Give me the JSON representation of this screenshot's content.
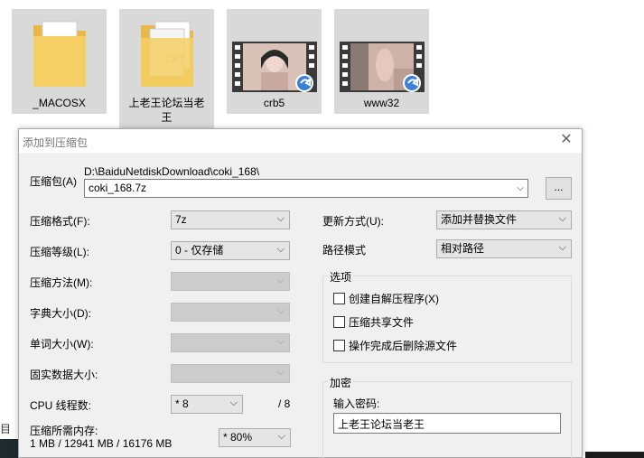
{
  "explorer": {
    "files": [
      {
        "name": "_MACOSX",
        "type": "folder"
      },
      {
        "name_line1": "上老王论坛当老",
        "name_line2": "王",
        "type": "folder"
      },
      {
        "name": "crb5",
        "type": "video"
      },
      {
        "name": "www32",
        "type": "video"
      }
    ],
    "left_edge_text": "目"
  },
  "dialog": {
    "title": "添加到压缩包",
    "archive": {
      "label": "压缩包(A)",
      "path": "D:\\BaiduNetdiskDownload\\coki_168\\",
      "filename": "coki_168.7z",
      "browse_label": "..."
    },
    "left": {
      "format_label": "压缩格式(F):",
      "format_value": "7z",
      "level_label": "压缩等级(L):",
      "level_value": "0 - 仅存储",
      "method_label": "压缩方法(M):",
      "dict_label": "字典大小(D):",
      "word_label": "单词大小(W):",
      "solid_label": "固实数据大小:",
      "threads_label": "CPU 线程数:",
      "threads_value": "* 8",
      "threads_max": "/ 8",
      "memory_label": "压缩所需内存:",
      "memory_stats": "1 MB / 12941 MB / 16176 MB",
      "memory_value": "* 80%"
    },
    "right": {
      "update_label": "更新方式(U):",
      "update_value": "添加并替换文件",
      "path_label": "路径模式",
      "path_value": "相对路径",
      "options_title": "选项",
      "opt_sfx": "创建自解压程序(X)",
      "opt_shared": "压缩共享文件",
      "opt_delete": "操作完成后删除源文件",
      "encrypt_title": "加密",
      "password_label": "输入密码:",
      "password_value": "上老王论坛当老王"
    }
  }
}
